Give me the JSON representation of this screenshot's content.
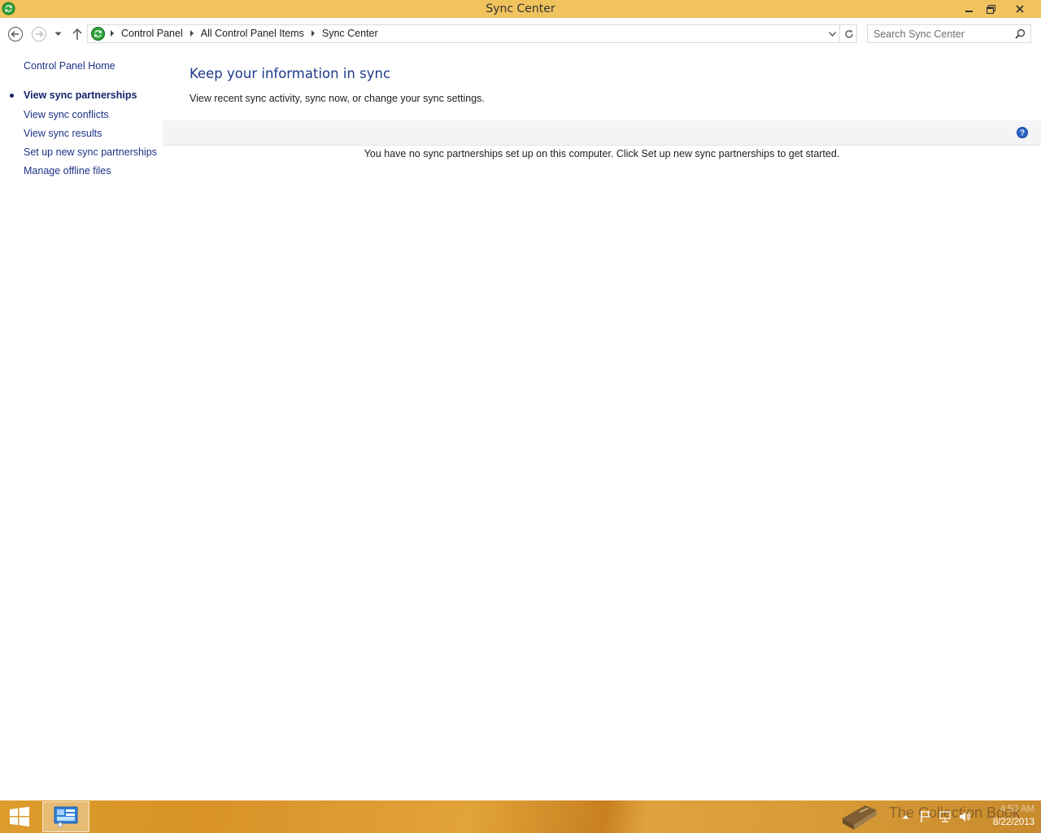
{
  "window": {
    "title": "Sync Center"
  },
  "address_bar": {
    "breadcrumbs": [
      "Control Panel",
      "All Control Panel Items",
      "Sync Center"
    ]
  },
  "search": {
    "placeholder": "Search Sync Center"
  },
  "sidebar": {
    "home_label": "Control Panel Home",
    "items": [
      {
        "label": "View sync partnerships",
        "active": true
      },
      {
        "label": "View sync conflicts",
        "active": false
      },
      {
        "label": "View sync results",
        "active": false
      },
      {
        "label": "Set up new sync partnerships",
        "active": false
      },
      {
        "label": "Manage offline files",
        "active": false
      }
    ]
  },
  "main": {
    "heading": "Keep your information in sync",
    "description": "View recent sync activity, sync now, or change your sync settings.",
    "empty_message": "You have no sync partnerships set up on this computer. Click Set up new sync partnerships to get started."
  },
  "taskbar": {
    "watermark": "The Collection Book",
    "clock_time": "4:50 AM",
    "clock_date": "8/22/2013"
  },
  "colors": {
    "titlebar": "#f0c35e",
    "link": "#1e3287",
    "heading": "#1e3a8a",
    "taskbar": "#dd9c2c"
  }
}
